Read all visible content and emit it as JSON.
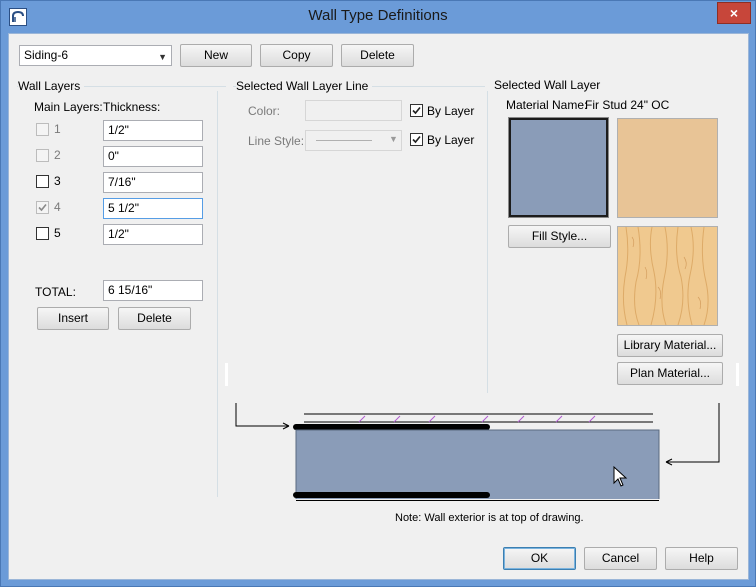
{
  "window": {
    "title": "Wall Type Definitions",
    "close_label": "×"
  },
  "toolbar": {
    "wall_type_selected": "Siding-6",
    "new_label": "New",
    "copy_label": "Copy",
    "delete_label": "Delete"
  },
  "wall_layers": {
    "title": "Wall Layers",
    "main_layers_header": "Main Layers:",
    "thickness_header": "Thickness:",
    "rows": [
      {
        "num": "1",
        "checked": false,
        "disabled": true,
        "thickness": "1/2\""
      },
      {
        "num": "2",
        "checked": false,
        "disabled": true,
        "thickness": "0\""
      },
      {
        "num": "3",
        "checked": false,
        "disabled": false,
        "thickness": "7/16\""
      },
      {
        "num": "4",
        "checked": true,
        "disabled": true,
        "thickness": "5 1/2\""
      },
      {
        "num": "5",
        "checked": false,
        "disabled": false,
        "thickness": "1/2\""
      }
    ],
    "total_label": "TOTAL:",
    "total_value": "6 15/16\"",
    "insert_label": "Insert",
    "delete_label": "Delete"
  },
  "layer_line": {
    "title": "Selected Wall Layer Line",
    "color_label": "Color:",
    "by_layer_label": "By Layer",
    "line_style_label": "Line Style:",
    "by_layer_label_2": "By Layer"
  },
  "wall_layer": {
    "title": "Selected Wall Layer",
    "material_label": "Material Name:",
    "material_value": "Fir Stud 24\" OC",
    "fill_style_label": "Fill Style...",
    "library_material_label": "Library Material...",
    "plan_material_label": "Plan Material..."
  },
  "preview": {
    "note": "Note: Wall exterior is at top of drawing."
  },
  "footer": {
    "ok_label": "OK",
    "cancel_label": "Cancel",
    "help_label": "Help"
  },
  "colors": {
    "fill_color": "#8a9cb8",
    "material_color": "#e8c496",
    "wood_color": "#f0c98f"
  }
}
